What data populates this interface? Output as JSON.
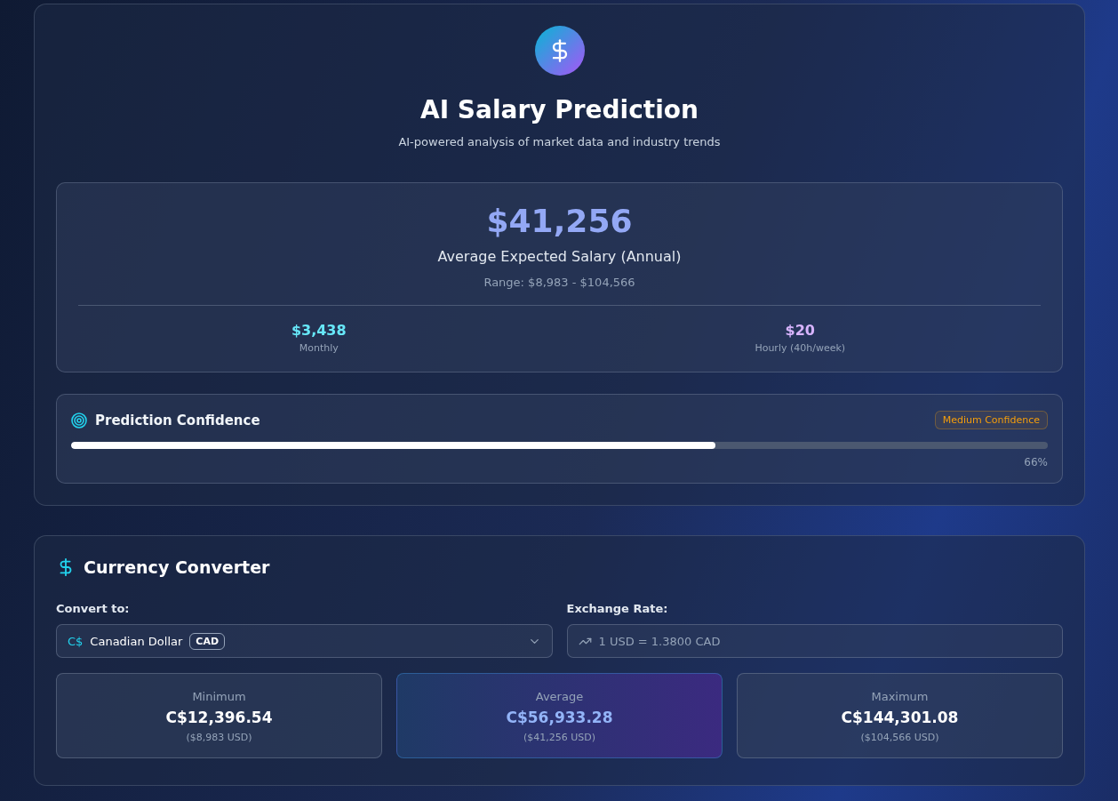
{
  "header": {
    "title": "AI Salary Prediction",
    "subtitle": "AI-powered analysis of market data and industry trends"
  },
  "salary": {
    "amount": "$41,256",
    "label": "Average Expected Salary (Annual)",
    "range": "Range: $8,983 - $104,566",
    "stats": [
      {
        "value": "$3,438",
        "label": "Monthly",
        "color": "#67e8f9"
      },
      {
        "value": "$20",
        "label": "Hourly (40h/week)",
        "color": "#d8b4fe"
      }
    ]
  },
  "confidence": {
    "title": "Prediction Confidence",
    "badge": "Medium Confidence",
    "level": 0.66,
    "reading": "66%"
  },
  "converter": {
    "title": "Currency Converter",
    "convert_label": "Convert to:",
    "currency_symbol": "C$",
    "currency_name": "Canadian Dollar",
    "currency_code": "CAD",
    "rate_label": "Exchange Rate:",
    "rate_value": "1 USD = 1.3800 CAD",
    "results": [
      {
        "label": "Minimum",
        "value": "C$12,396.54",
        "usd": "($8,983 USD)",
        "highlighted": false
      },
      {
        "label": "Average",
        "value": "C$56,933.28",
        "usd": "($41,256 USD)",
        "highlighted": true
      },
      {
        "label": "Maximum",
        "value": "C$144,301.08",
        "usd": "($104,566 USD)",
        "highlighted": false
      }
    ]
  }
}
